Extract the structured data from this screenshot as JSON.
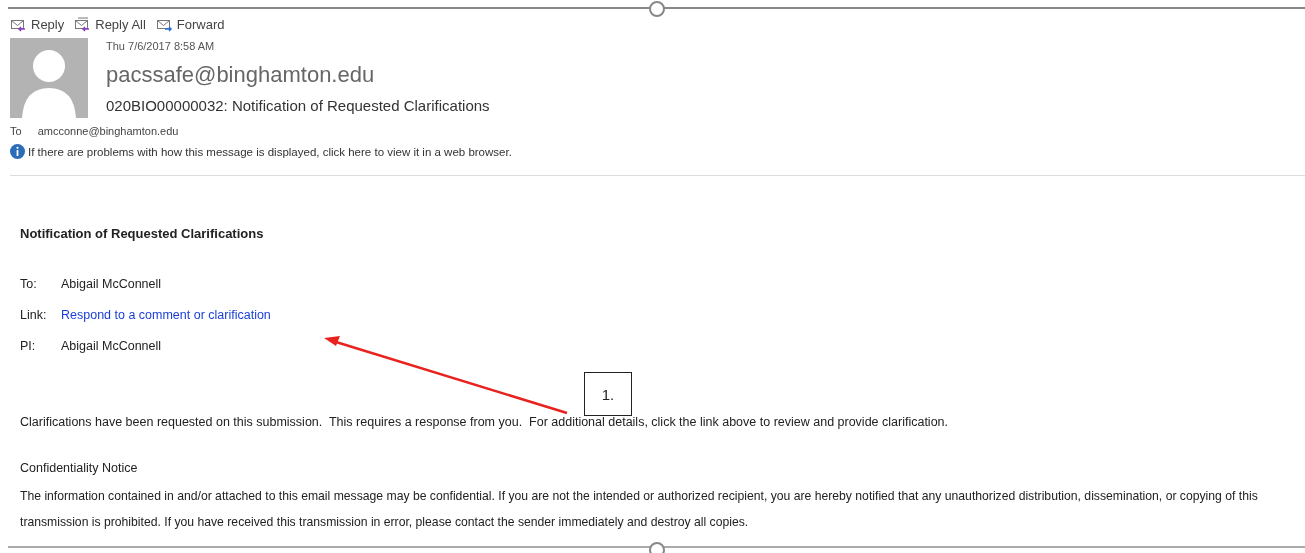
{
  "toolbar": [
    {
      "label": "Reply",
      "kind": "reply"
    },
    {
      "label": "Reply All",
      "kind": "reply-all"
    },
    {
      "label": "Forward",
      "kind": "forward"
    }
  ],
  "header": {
    "date": "Thu 7/6/2017 8:58 AM",
    "sender": "pacssafe@binghamton.edu",
    "subject": "020BIO00000032: Notification of Requested Clarifications",
    "to_label": "To",
    "to": "amcconne@binghamton.edu",
    "info": "If there are problems with how this message is displayed, click here to view it in a web browser."
  },
  "body": {
    "title": "Notification of Requested Clarifications",
    "fields": [
      {
        "label": "To:",
        "value": "Abigail McConnell",
        "kind": "text"
      },
      {
        "label": "Link:",
        "value": "Respond to a comment or clarification",
        "kind": "link"
      },
      {
        "label": "PI:",
        "value": "Abigail McConnell",
        "kind": "text"
      }
    ],
    "message": "Clarifications have been requested on this submission.  This requires a response from you.  For additional details, click the link above to review and provide clarification.",
    "notice_title": "Confidentiality Notice",
    "notice": "The information contained in and/or attached to this email message may be confidential. If you are not the intended or authorized recipient, you are hereby notified that any unauthorized distribution, dissemination, or copying of this transmission is prohibited. If you have received this transmission in error, please contact the sender immediately and destroy all copies."
  },
  "callout": {
    "label": "1."
  }
}
